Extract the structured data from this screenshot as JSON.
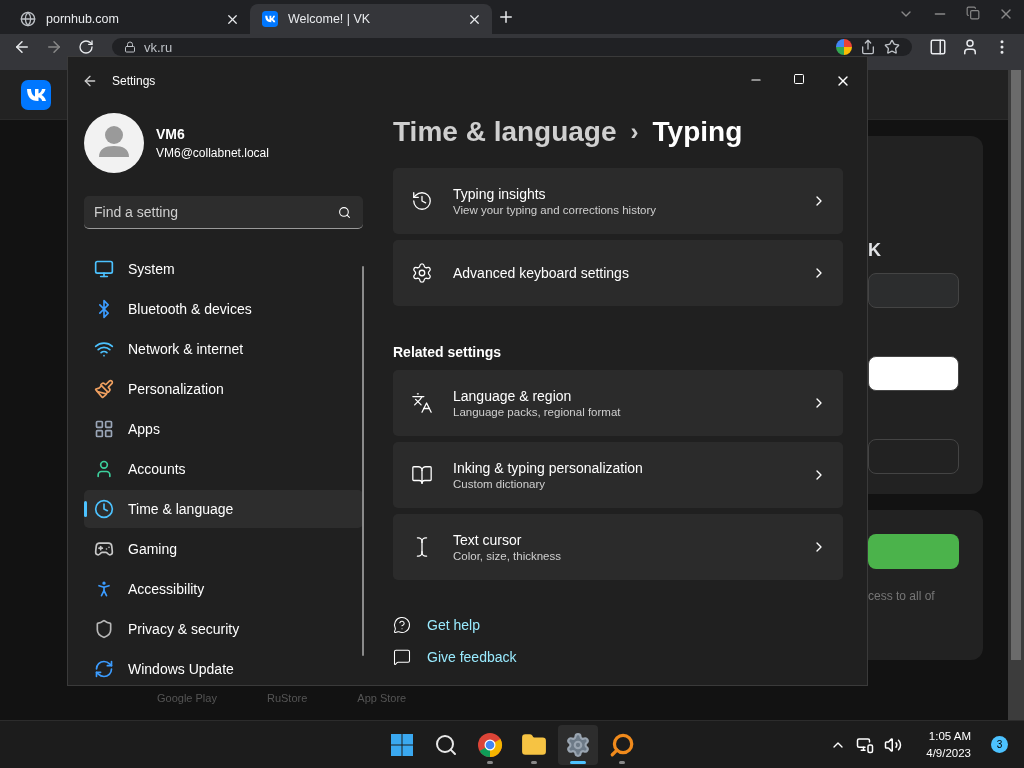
{
  "browser": {
    "tabs": [
      {
        "title": "pornhub.com",
        "selected": false
      },
      {
        "title": "Welcome! | VK",
        "selected": true
      }
    ],
    "address": "vk.ru",
    "page": {
      "card_heading": "K",
      "card_text": "cess to all of",
      "store_links": [
        "Google Play",
        "RuStore",
        "App Store"
      ]
    }
  },
  "settings": {
    "window_title": "Settings",
    "user": {
      "name": "VM6",
      "email": "VM6@collabnet.local"
    },
    "search": {
      "placeholder": "Find a setting"
    },
    "nav": [
      {
        "label": "System",
        "selected": false
      },
      {
        "label": "Bluetooth & devices",
        "selected": false
      },
      {
        "label": "Network & internet",
        "selected": false
      },
      {
        "label": "Personalization",
        "selected": false
      },
      {
        "label": "Apps",
        "selected": false
      },
      {
        "label": "Accounts",
        "selected": false
      },
      {
        "label": "Time & language",
        "selected": true
      },
      {
        "label": "Gaming",
        "selected": false
      },
      {
        "label": "Accessibility",
        "selected": false
      },
      {
        "label": "Privacy & security",
        "selected": false
      },
      {
        "label": "Windows Update",
        "selected": false
      }
    ],
    "breadcrumb": {
      "parent": "Time & language",
      "separator": "›",
      "current": "Typing"
    },
    "cards": [
      {
        "title": "Typing insights",
        "subtitle": "View your typing and corrections history"
      },
      {
        "title": "Advanced keyboard settings"
      }
    ],
    "related_heading": "Related settings",
    "related": [
      {
        "title": "Language & region",
        "subtitle": "Language packs, regional format"
      },
      {
        "title": "Inking & typing personalization",
        "subtitle": "Custom dictionary"
      },
      {
        "title": "Text cursor",
        "subtitle": "Color, size, thickness"
      }
    ],
    "links": [
      "Get help",
      "Give feedback"
    ]
  },
  "taskbar": {
    "apps": [
      {
        "running": false,
        "selected": false
      },
      {
        "running": false,
        "selected": false
      },
      {
        "running": true,
        "selected": false
      },
      {
        "running": true,
        "selected": false
      },
      {
        "running": true,
        "selected": true
      },
      {
        "running": true,
        "selected": false
      }
    ],
    "time": "1:05 AM",
    "date": "4/9/2023",
    "notifications": "3"
  }
}
